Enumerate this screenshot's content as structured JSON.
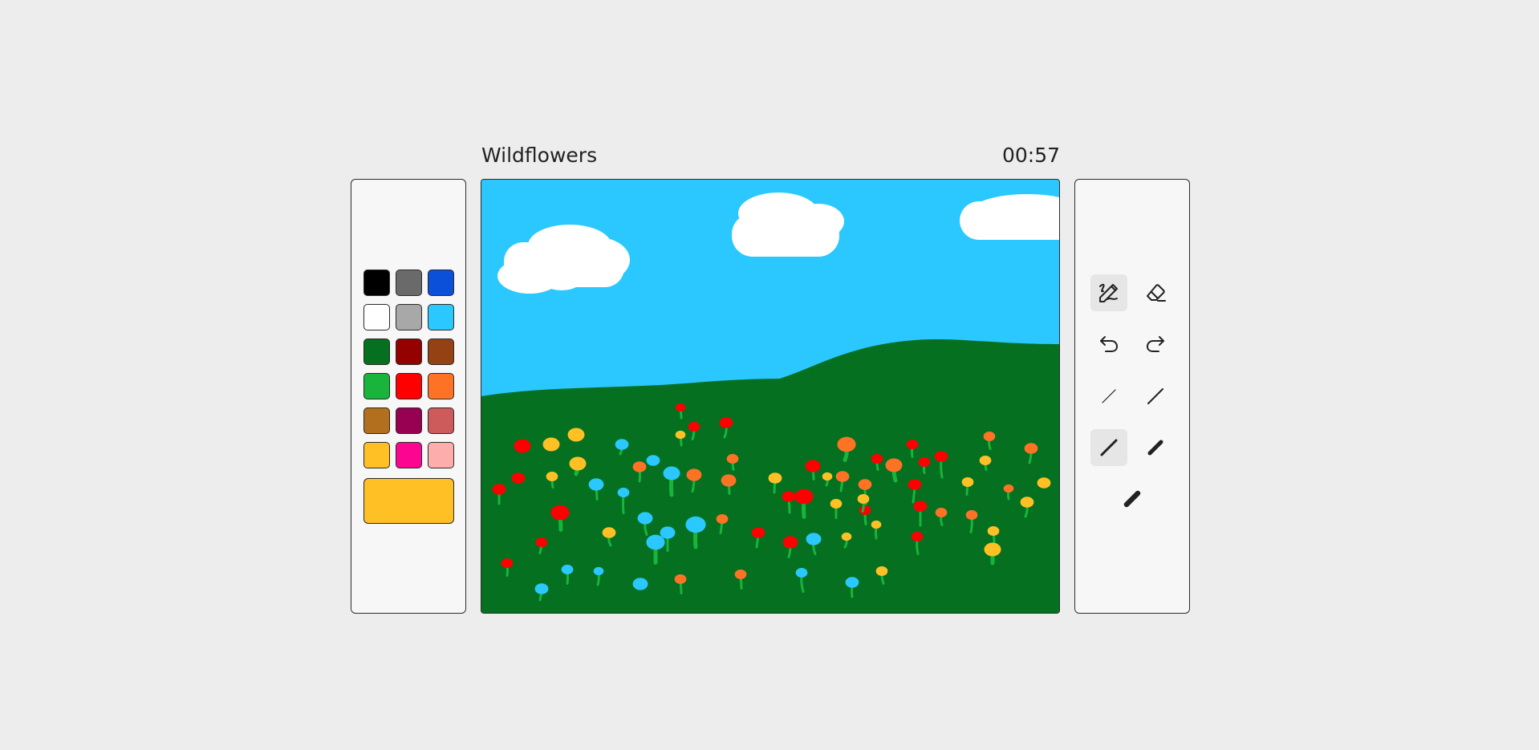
{
  "header": {
    "title": "Wildflowers",
    "timer": "00:57"
  },
  "palette": {
    "colors": [
      "#000000",
      "#6a6a6a",
      "#0a50d8",
      "#ffffff",
      "#a8a8a8",
      "#2ac8fe",
      "#047020",
      "#950000",
      "#944214",
      "#19b43b",
      "#fe0000",
      "#fe7225",
      "#b26f1d",
      "#980051",
      "#ce5b5b",
      "#ffc025",
      "#fc0590",
      "#fdaeac"
    ],
    "current_color": "#ffc025"
  },
  "tools": {
    "brush": {
      "icon": "brush-icon",
      "active": true
    },
    "eraser": {
      "icon": "eraser-icon",
      "active": false
    },
    "undo": {
      "icon": "undo-icon"
    },
    "redo": {
      "icon": "redo-icon"
    },
    "sizes": [
      {
        "name": "size-1",
        "active": false
      },
      {
        "name": "size-2",
        "active": false
      },
      {
        "name": "size-3",
        "active": true
      },
      {
        "name": "size-4",
        "active": false
      },
      {
        "name": "size-5",
        "active": false
      }
    ]
  },
  "colors": {
    "sky": "#2ac8fe",
    "grass": "#047020",
    "cloud": "#ffffff",
    "stem": "#19b43b"
  }
}
